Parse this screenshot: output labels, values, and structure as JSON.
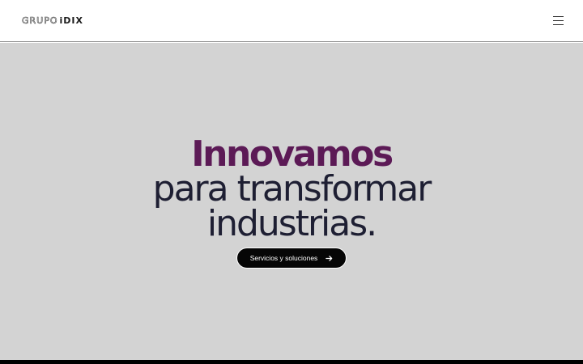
{
  "header": {
    "logo": {
      "part1": "GRUPO",
      "part2": "iDIX"
    },
    "menu_icon": "hamburger-menu-icon"
  },
  "hero": {
    "line1": "Innovamos",
    "line2": "para transformar",
    "line3": "industrias.",
    "cta_label": "Servicios y soluciones",
    "cta_icon": "arrow-right-icon"
  },
  "colors": {
    "accent": "#5c1a56",
    "text": "#1e1f33",
    "hero_bg": "#d3d3d3",
    "button_bg": "#060606"
  }
}
